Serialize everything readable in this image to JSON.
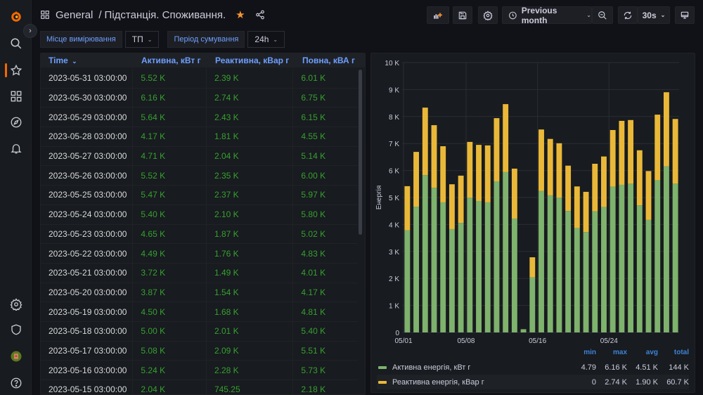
{
  "sidebar": {
    "items": [
      {
        "name": "grafana-logo",
        "label": "Home"
      },
      {
        "name": "search-icon",
        "label": "Search"
      },
      {
        "name": "star-icon",
        "label": "Starred",
        "active": true
      },
      {
        "name": "dashboards-icon",
        "label": "Dashboards"
      },
      {
        "name": "explore-icon",
        "label": "Explore"
      },
      {
        "name": "bell-icon",
        "label": "Alerting"
      },
      {
        "name": "gear-icon",
        "label": "Configuration"
      },
      {
        "name": "shield-icon",
        "label": "Server admin"
      },
      {
        "name": "avatar",
        "label": "Profile"
      },
      {
        "name": "help-icon",
        "label": "Help"
      }
    ]
  },
  "header": {
    "folder": "General",
    "separator": "/",
    "title": "Підстанція. Споживання.",
    "starred": true
  },
  "toolbar": {
    "time_range": "Previous month",
    "refresh_interval": "30s"
  },
  "variables": [
    {
      "label": "Місце вимірювання",
      "value": "ТП"
    },
    {
      "label": "Період сумування",
      "value": "24h"
    }
  ],
  "table": {
    "columns": [
      "Time",
      "Активна, кВт г",
      "Реактивна, кВар г",
      "Повна, кВА г"
    ],
    "sort_indicator": "⌄",
    "rows": [
      [
        "2023-05-31 03:00:00",
        "5.52 K",
        "2.39 K",
        "6.01 K"
      ],
      [
        "2023-05-30 03:00:00",
        "6.16 K",
        "2.74 K",
        "6.75 K"
      ],
      [
        "2023-05-29 03:00:00",
        "5.64 K",
        "2.43 K",
        "6.15 K"
      ],
      [
        "2023-05-28 03:00:00",
        "4.17 K",
        "1.81 K",
        "4.55 K"
      ],
      [
        "2023-05-27 03:00:00",
        "4.71 K",
        "2.04 K",
        "5.14 K"
      ],
      [
        "2023-05-26 03:00:00",
        "5.52 K",
        "2.35 K",
        "6.00 K"
      ],
      [
        "2023-05-25 03:00:00",
        "5.47 K",
        "2.37 K",
        "5.97 K"
      ],
      [
        "2023-05-24 03:00:00",
        "5.40 K",
        "2.10 K",
        "5.80 K"
      ],
      [
        "2023-05-23 03:00:00",
        "4.65 K",
        "1.87 K",
        "5.02 K"
      ],
      [
        "2023-05-22 03:00:00",
        "4.49 K",
        "1.76 K",
        "4.83 K"
      ],
      [
        "2023-05-21 03:00:00",
        "3.72 K",
        "1.49 K",
        "4.01 K"
      ],
      [
        "2023-05-20 03:00:00",
        "3.87 K",
        "1.54 K",
        "4.17 K"
      ],
      [
        "2023-05-19 03:00:00",
        "4.50 K",
        "1.68 K",
        "4.81 K"
      ],
      [
        "2023-05-18 03:00:00",
        "5.00 K",
        "2.01 K",
        "5.40 K"
      ],
      [
        "2023-05-17 03:00:00",
        "5.08 K",
        "2.09 K",
        "5.51 K"
      ],
      [
        "2023-05-16 03:00:00",
        "5.24 K",
        "2.28 K",
        "5.73 K"
      ],
      [
        "2023-05-15 03:00:00",
        "2.04 K",
        "745.25",
        "2.18 K"
      ]
    ]
  },
  "chart_data": {
    "type": "bar",
    "stacked": true,
    "ylabel": "Енергія",
    "xlabel": "",
    "ylim": [
      0,
      10000
    ],
    "yticks": [
      "0",
      "1 K",
      "2 K",
      "3 K",
      "4 K",
      "5 K",
      "6 K",
      "7 K",
      "8 K",
      "9 K",
      "10 K"
    ],
    "xticks": [
      {
        "label": "05/01",
        "index": 0
      },
      {
        "label": "05/08",
        "index": 7
      },
      {
        "label": "05/16",
        "index": 15
      },
      {
        "label": "05/24",
        "index": 23
      }
    ],
    "grid": true,
    "categories": [
      "05/01",
      "05/02",
      "05/03",
      "05/04",
      "05/05",
      "05/06",
      "05/07",
      "05/08",
      "05/09",
      "05/10",
      "05/11",
      "05/12",
      "05/13",
      "05/14",
      "05/15",
      "05/16",
      "05/17",
      "05/18",
      "05/19",
      "05/20",
      "05/21",
      "05/22",
      "05/23",
      "05/24",
      "05/25",
      "05/26",
      "05/27",
      "05/28",
      "05/29",
      "05/30",
      "05/31"
    ],
    "series": [
      {
        "name": "Активна енергія, кВт г",
        "color": "#7eb26d",
        "values": [
          3780,
          4660,
          5830,
          5360,
          4820,
          3830,
          4060,
          5000,
          4870,
          4820,
          5600,
          5940,
          4220,
          120,
          2040,
          5240,
          5080,
          5000,
          4500,
          3870,
          3720,
          4490,
          4650,
          5400,
          5470,
          5520,
          4710,
          4170,
          5640,
          6160,
          5520
        ]
      },
      {
        "name": "Реактивна енергія, кВар г",
        "color": "#eab839",
        "values": [
          1640,
          2030,
          2500,
          2320,
          2080,
          1660,
          1750,
          2060,
          2080,
          2110,
          2340,
          2520,
          1850,
          0,
          745.25,
          2280,
          2090,
          2010,
          1680,
          1540,
          1490,
          1760,
          1870,
          2100,
          2370,
          2350,
          2040,
          1810,
          2430,
          2740,
          2390
        ]
      }
    ],
    "legend": {
      "placement": "bottom",
      "columns": [
        "min",
        "max",
        "avg",
        "total"
      ],
      "rows": [
        {
          "name": "Активна енергія, кВт г",
          "color": "#7eb26d",
          "min": "4.79",
          "max": "6.16 K",
          "avg": "4.51 K",
          "total": "144 K"
        },
        {
          "name": "Реактивна енергія, кВар г",
          "color": "#eab839",
          "min": "0",
          "max": "2.74 K",
          "avg": "1.90 K",
          "total": "60.7 K"
        }
      ]
    }
  }
}
